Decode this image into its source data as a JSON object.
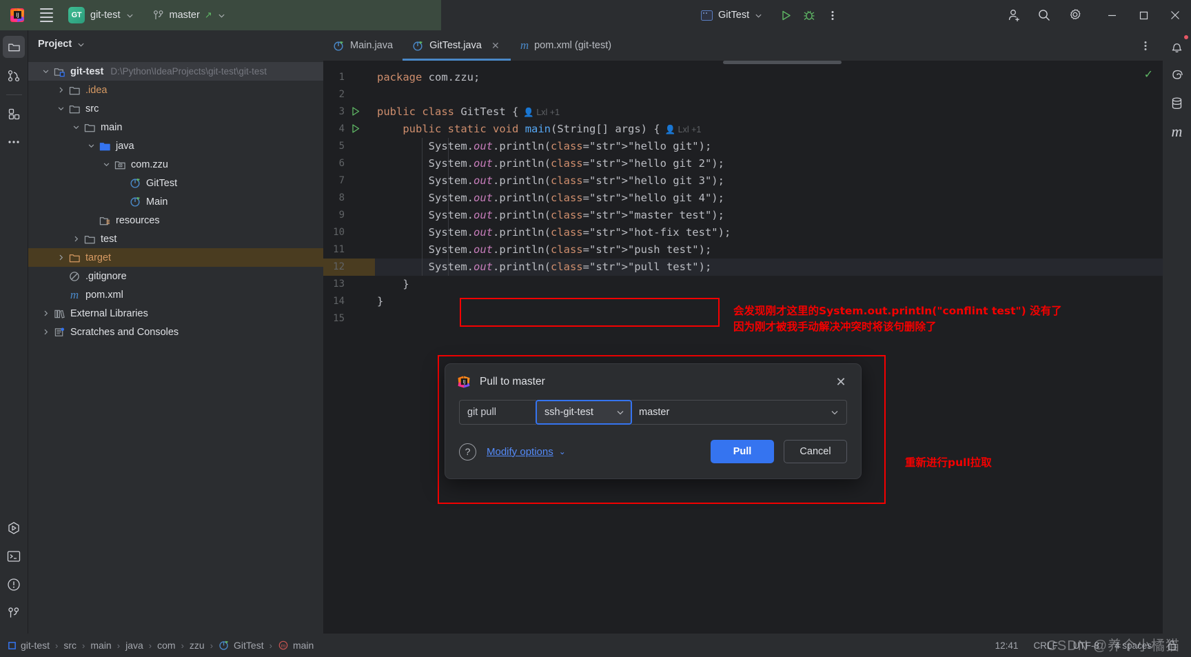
{
  "titlebar": {
    "project_badge": "GT",
    "project_name": "git-test",
    "branch_name": "master",
    "run_config": "GitTest",
    "icons": {
      "menu": "hamburger-icon",
      "logo": "intellij-logo-icon",
      "branch": "git-branch-icon",
      "run": "run-icon",
      "debug": "debug-icon",
      "more": "more-vertical-icon",
      "account": "add-account-icon",
      "search": "search-icon",
      "settings": "gear-icon",
      "minimize": "minimize-icon",
      "maximize": "maximize-icon",
      "close": "close-icon"
    }
  },
  "left_stripe": {
    "items": [
      {
        "name": "project",
        "icon": "folder-icon",
        "active": true
      },
      {
        "name": "commit",
        "icon": "commit-icon",
        "active": false
      },
      {
        "name": "structure",
        "icon": "structure-icon",
        "active": false
      },
      {
        "name": "more-tools",
        "icon": "ellipsis-icon",
        "active": false
      }
    ],
    "bottom_items": [
      {
        "name": "run",
        "icon": "run-hex-icon"
      },
      {
        "name": "terminal",
        "icon": "terminal-icon"
      },
      {
        "name": "problems",
        "icon": "warning-circle-icon"
      },
      {
        "name": "git",
        "icon": "git-branch-icon"
      }
    ]
  },
  "right_stripe": {
    "items": [
      {
        "name": "notifications",
        "icon": "bell-icon",
        "badge": true
      },
      {
        "name": "ai-assistant",
        "icon": "spiral-icon",
        "badge": false
      },
      {
        "name": "database",
        "icon": "database-icon",
        "badge": false
      },
      {
        "name": "maven",
        "icon": "maven-m-icon",
        "badge": false
      }
    ]
  },
  "project_panel": {
    "title": "Project",
    "tree": [
      {
        "label": "git-test",
        "path": "D:\\Python\\IdeaProjects\\git-test\\git-test",
        "depth": 0,
        "arrow": "down",
        "icon": "module-icon",
        "selected": true,
        "bold": true
      },
      {
        "label": ".idea",
        "path": "",
        "depth": 1,
        "arrow": "right",
        "icon": "folder-icon",
        "color": "orange"
      },
      {
        "label": "src",
        "path": "",
        "depth": 1,
        "arrow": "down",
        "icon": "folder-icon"
      },
      {
        "label": "main",
        "path": "",
        "depth": 2,
        "arrow": "down",
        "icon": "folder-icon"
      },
      {
        "label": "java",
        "path": "",
        "depth": 3,
        "arrow": "down",
        "icon": "source-folder-icon"
      },
      {
        "label": "com.zzu",
        "path": "",
        "depth": 4,
        "arrow": "down",
        "icon": "package-icon"
      },
      {
        "label": "GitTest",
        "path": "",
        "depth": 5,
        "arrow": "none",
        "icon": "java-class-icon"
      },
      {
        "label": "Main",
        "path": "",
        "depth": 5,
        "arrow": "none",
        "icon": "java-class-icon"
      },
      {
        "label": "resources",
        "path": "",
        "depth": 3,
        "arrow": "none",
        "icon": "resources-folder-icon"
      },
      {
        "label": "test",
        "path": "",
        "depth": 2,
        "arrow": "right",
        "icon": "folder-icon"
      },
      {
        "label": "target",
        "path": "",
        "depth": 1,
        "arrow": "right",
        "icon": "excluded-folder-icon",
        "color": "orange",
        "highlighted": true
      },
      {
        "label": ".gitignore",
        "path": "",
        "depth": 1,
        "arrow": "none",
        "icon": "gitignore-icon"
      },
      {
        "label": "pom.xml",
        "path": "",
        "depth": 1,
        "arrow": "none",
        "icon": "maven-m-icon"
      },
      {
        "label": "External Libraries",
        "path": "",
        "depth": 0,
        "arrow": "right",
        "icon": "libraries-icon"
      },
      {
        "label": "Scratches and Consoles",
        "path": "",
        "depth": 0,
        "arrow": "right",
        "icon": "scratches-icon"
      }
    ]
  },
  "editor": {
    "tabs": [
      {
        "label": "Main.java",
        "icon": "java-class-icon",
        "active": false,
        "closable": false
      },
      {
        "label": "GitTest.java",
        "icon": "java-class-icon",
        "active": true,
        "closable": true
      },
      {
        "label": "pom.xml (git-test)",
        "icon": "maven-m-icon",
        "active": false,
        "closable": false
      }
    ],
    "tab_options_icon": "more-vertical-icon",
    "inspection_status": "ok-check-icon",
    "inlay_hint": "Lxl +1",
    "lines": [
      {
        "n": 1,
        "text": "package com.zzu;"
      },
      {
        "n": 2,
        "text": ""
      },
      {
        "n": 3,
        "text": "public class GitTest {"
      },
      {
        "n": 4,
        "text": "    public static void main(String[] args) {"
      },
      {
        "n": 5,
        "text": "        System.out.println(\"hello git\");"
      },
      {
        "n": 6,
        "text": "        System.out.println(\"hello git 2\");"
      },
      {
        "n": 7,
        "text": "        System.out.println(\"hello git 3\");"
      },
      {
        "n": 8,
        "text": "        System.out.println(\"hello git 4\");"
      },
      {
        "n": 9,
        "text": "        System.out.println(\"master test\");"
      },
      {
        "n": 10,
        "text": "        System.out.println(\"hot-fix test\");"
      },
      {
        "n": 11,
        "text": "        System.out.println(\"push test\");"
      },
      {
        "n": 12,
        "text": "        System.out.println(\"pull test\");"
      },
      {
        "n": 13,
        "text": "    }"
      },
      {
        "n": 14,
        "text": "}"
      },
      {
        "n": 15,
        "text": ""
      }
    ],
    "current_line": 12
  },
  "dialog": {
    "title": "Pull to master",
    "icon": "intellij-logo-icon",
    "close_icon": "close-icon",
    "command": "git pull",
    "remote": "ssh-git-test",
    "branch": "master",
    "help_icon": "question-mark-icon",
    "modify_options": "Modify options",
    "pull_button": "Pull",
    "cancel_button": "Cancel",
    "accent_color": "#3574f0"
  },
  "annotations": {
    "color": "#f50000",
    "note_1_line_1": "会发现刚才这里的System.out.println(\"conflint test\") 没有了",
    "note_1_line_2": "因为刚才被我手动解决冲突时将该句删除了",
    "note_2": "重新进行pull拉取"
  },
  "status_bar": {
    "breadcrumbs": [
      {
        "label": "git-test",
        "icon": "module-icon"
      },
      {
        "label": "src",
        "icon": "none"
      },
      {
        "label": "main",
        "icon": "none"
      },
      {
        "label": "java",
        "icon": "none"
      },
      {
        "label": "com",
        "icon": "none"
      },
      {
        "label": "zzu",
        "icon": "none"
      },
      {
        "label": "GitTest",
        "icon": "java-class-icon"
      },
      {
        "label": "main",
        "icon": "method-icon"
      }
    ],
    "time": "12:41",
    "line_sep": "CRLF",
    "encoding": "UTF-8",
    "indent": "4 spaces",
    "lock_icon": "lock-icon",
    "watermark": "CSDN @养个小橘猫"
  }
}
